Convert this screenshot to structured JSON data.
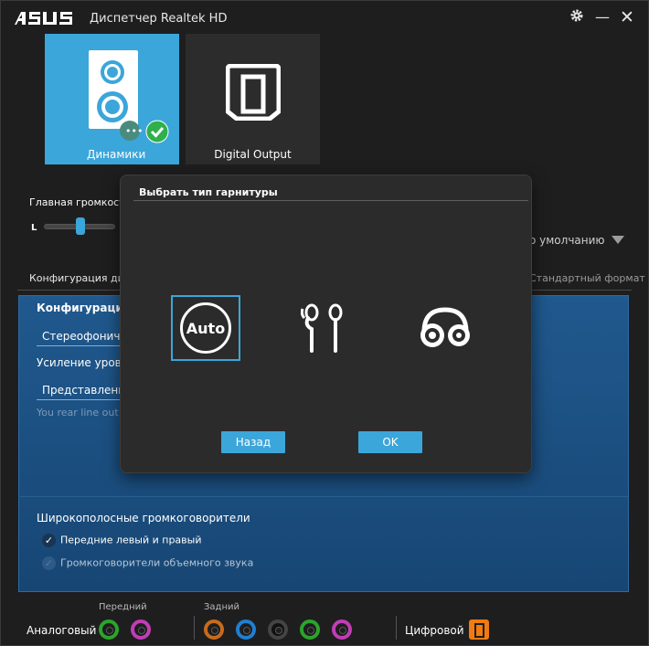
{
  "window": {
    "brand": "/ISUS",
    "title": "Диспетчер Realtek HD",
    "controls": {
      "settings_icon": "gear-icon",
      "minimize": "—",
      "close": "✕"
    }
  },
  "devices": [
    {
      "label": "Динамики",
      "active": true
    },
    {
      "label": "Digital Output",
      "active": false
    }
  ],
  "volume": {
    "label": "Главная громкость",
    "left_channel": "L",
    "level": 0.52
  },
  "default_device": {
    "label": "о умолчанию"
  },
  "tabs": {
    "config": "Конфигурация дин",
    "format": "Стандартный формат"
  },
  "config_panel": {
    "title": "Конфигурация д",
    "speaker_config": "Стереофонич",
    "gain": "Усиление уровн",
    "representation": "Представление",
    "note": "You rear line out i"
  },
  "fullrange": {
    "title": "Широкополосные громкоговорители",
    "front": {
      "label": "Передние левый и правый",
      "checked": true
    },
    "surround": {
      "label": "Громкоговорители объемного звука",
      "checked": true,
      "disabled": true
    }
  },
  "jacks": {
    "front_label": "Передний",
    "rear_label": "Задний",
    "analog_label": "Аналоговый",
    "digital_label": "Цифровой",
    "front_colors": [
      "#2aa52a",
      "#c13db5"
    ],
    "rear_colors": [
      "#c86a1c",
      "#1f7fd1",
      "#222222",
      "#2aa52a",
      "#c13db5"
    ],
    "digital_color": "#f07b12"
  },
  "modal": {
    "title": "Выбрать тип гарнитуры",
    "options": [
      {
        "label": "Auto",
        "icon": "auto-icon",
        "selected": true
      },
      {
        "label": "",
        "icon": "earbuds-icon",
        "selected": false
      },
      {
        "label": "",
        "icon": "headphones-icon",
        "selected": false
      }
    ],
    "back_button": "Назад",
    "ok_button": "OK"
  },
  "colors": {
    "accent": "#3ba6d9",
    "panel_blue": "#1d5285",
    "background": "#1e1e1f",
    "modal": "#2b2b2c"
  }
}
